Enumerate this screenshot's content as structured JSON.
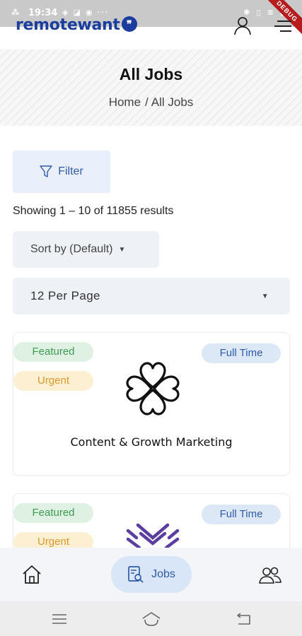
{
  "status_bar": {
    "time": "19:34",
    "left_icons": "⁂",
    "mid_icons": "◈ ◪ ◉ ···",
    "right_icons": "✱ ▯ ≋ ▮",
    "debug_label": "DEBUG"
  },
  "header": {
    "logo_text": "remotewant",
    "logo_badge": "❞",
    "user_icon": "user-icon",
    "menu_icon": "menu-icon"
  },
  "hero": {
    "title": "All Jobs",
    "breadcrumb_home": "Home",
    "breadcrumb_separator": "/",
    "breadcrumb_current": "All Jobs"
  },
  "filter": {
    "label": "Filter",
    "icon": "filter-icon"
  },
  "results_text": "Showing 1 – 10 of 11855 results",
  "sort": {
    "selected": "Sort by (Default)"
  },
  "per_page": {
    "selected": "12 Per Page"
  },
  "jobs": [
    {
      "badges": [
        "Featured",
        "Urgent"
      ],
      "type": "Full Time",
      "title": "Content & Growth Marketing",
      "logo_icon": "clover-logo-icon"
    },
    {
      "badges": [
        "Featured",
        "Urgent"
      ],
      "type": "Full Time",
      "title": "",
      "logo_icon": "chevron-stack-logo-icon"
    }
  ],
  "bottom_nav": {
    "home_icon": "home-icon",
    "jobs_label": "Jobs",
    "jobs_icon": "job-search-icon",
    "people_icon": "people-icon"
  },
  "colors": {
    "brand": "#1a3d9e",
    "accent": "#2e5ba8",
    "featured_bg": "#dff1e3",
    "featured_text": "#3f9a55",
    "urgent_bg": "#fcefd2",
    "urgent_text": "#d99a2b",
    "fulltime_bg": "#dde8f7",
    "logo2_color": "#5b3fa0"
  }
}
